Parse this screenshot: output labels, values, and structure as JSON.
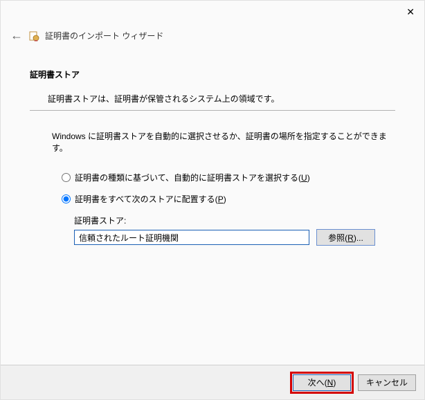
{
  "window": {
    "close_label": "✕",
    "back_label": "←",
    "title": "証明書のインポート ウィザード"
  },
  "page": {
    "section_title": "証明書ストア",
    "section_desc": "証明書ストアは、証明書が保管されるシステム上の領域です。",
    "instruction": "Windows に証明書ストアを自動的に選択させるか、証明書の場所を指定することができます。"
  },
  "options": {
    "auto": {
      "label_pre": "証明書の種類に基づいて、自動的に証明書ストアを選択する(",
      "mnemonic": "U",
      "label_post": ")",
      "checked": false
    },
    "manual": {
      "label_pre": "証明書をすべて次のストアに配置する(",
      "mnemonic": "P",
      "label_post": ")",
      "checked": true
    }
  },
  "store": {
    "label": "証明書ストア:",
    "value": "信頼されたルート証明機関",
    "browse_pre": "参照(",
    "browse_mnemonic": "R",
    "browse_post": ")..."
  },
  "footer": {
    "next_pre": "次へ(",
    "next_mnemonic": "N",
    "next_post": ")",
    "cancel": "キャンセル"
  }
}
